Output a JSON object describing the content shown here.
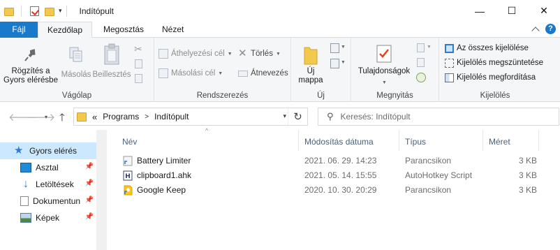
{
  "window": {
    "title": "Indítópult",
    "controls": {
      "minimize": "—",
      "maximize": "☐",
      "close": "✕"
    }
  },
  "ribbon_tabs": [
    "Fájl",
    "Kezdőlap",
    "Megosztás",
    "Nézet"
  ],
  "ribbon": {
    "clipboard": {
      "label": "Vágólap",
      "pin": [
        "Rögzítés a",
        "Gyors elérésbe"
      ],
      "copy": "Másolás",
      "paste": "Beillesztés"
    },
    "organize": {
      "label": "Rendszerezés",
      "move_to": "Áthelyezési cél",
      "copy_to": "Másolási cél",
      "delete": "Törlés",
      "rename": "Átnevezés"
    },
    "new": {
      "label": "Új",
      "new_folder": [
        "Új",
        "mappa"
      ]
    },
    "open": {
      "label": "Megnyitás",
      "properties": "Tulajdonságok"
    },
    "select": {
      "label": "Kijelölés",
      "select_all": "Az összes kijelölése",
      "select_none": "Kijelölés megszüntetése",
      "invert": "Kijelölés megfordítása"
    }
  },
  "address": {
    "overflow": "«",
    "crumbs": [
      "Programs",
      "Indítópult"
    ]
  },
  "search": {
    "placeholder": "Keresés: Indítópult"
  },
  "sidebar": {
    "items": [
      {
        "label": "Gyors elérés",
        "icon": "star-icon",
        "selected": true
      },
      {
        "label": "Asztal",
        "icon": "desktop-icon",
        "pinned": true
      },
      {
        "label": "Letöltések",
        "icon": "download-icon",
        "pinned": true
      },
      {
        "label": "Dokumentun",
        "icon": "document-icon",
        "pinned": true
      },
      {
        "label": "Képek",
        "icon": "pictures-icon",
        "pinned": true
      }
    ]
  },
  "columns": {
    "name": "Név",
    "date": "Módosítás dátuma",
    "type": "Típus",
    "size": "Méret"
  },
  "files": [
    {
      "name": "Battery Limiter",
      "date": "2021. 06. 29. 14:23",
      "type": "Parancsikon",
      "size": "3 KB",
      "icon": "shortcut-icon"
    },
    {
      "name": "clipboard1.ahk",
      "date": "2021. 05. 14. 15:55",
      "type": "AutoHotkey Script",
      "size": "3 KB",
      "icon": "ahk-script-icon"
    },
    {
      "name": "Google Keep",
      "date": "2020. 10. 30. 20:29",
      "type": "Parancsikon",
      "size": "3 KB",
      "icon": "keep-shortcut-icon"
    }
  ],
  "colors": {
    "accent": "#1979ca",
    "selection": "#cce8ff",
    "folder": "#f3c94d"
  }
}
